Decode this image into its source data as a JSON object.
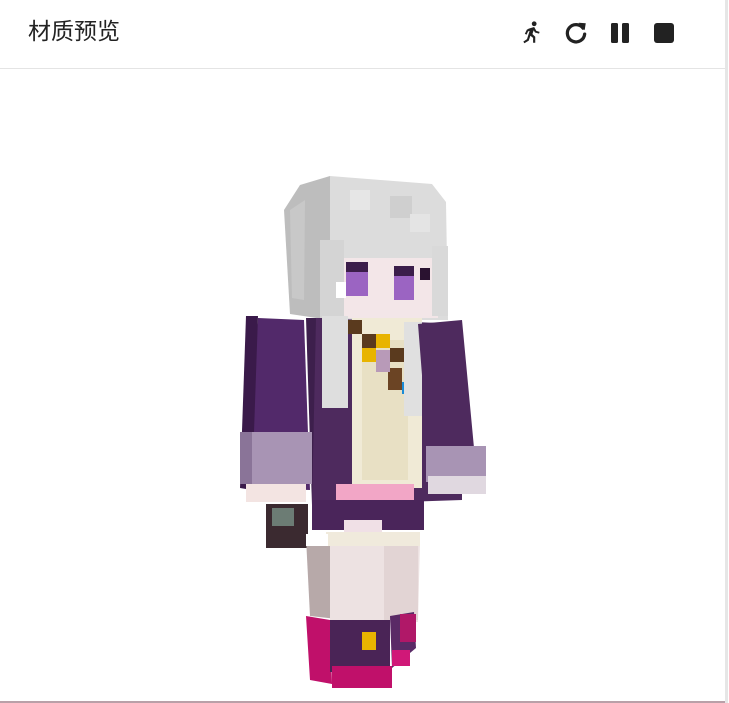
{
  "header": {
    "title": "材质预览"
  },
  "controls": [
    {
      "name": "run-icon"
    },
    {
      "name": "reload-icon"
    },
    {
      "name": "pause-icon"
    },
    {
      "name": "stop-icon"
    }
  ],
  "colors": {
    "hair": "#d9d9d9",
    "coat": "#4e2a5e",
    "sleeve_cuff": "#a894b4",
    "shirt": "#f0ead6",
    "leg": "#ede2e2",
    "boot": "#4a2456",
    "boot_trim": "#c0106a",
    "accent_gold": "#e8b400",
    "accent_blue": "#1a8bd6",
    "eye": "#9b64c2"
  }
}
